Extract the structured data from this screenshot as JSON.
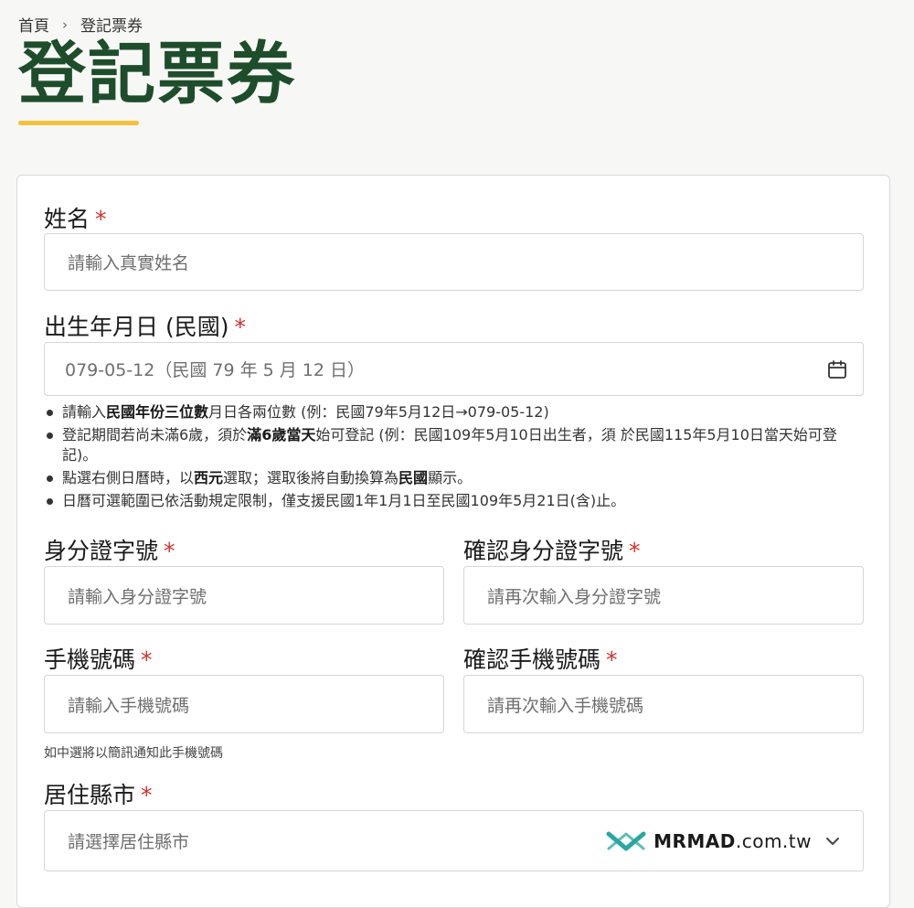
{
  "breadcrumb": {
    "home": "首頁",
    "separator": "›",
    "current": "登記票券"
  },
  "page": {
    "title": "登記票券"
  },
  "form": {
    "required_mark": "*",
    "name": {
      "label": "姓名",
      "placeholder": "請輸入真實姓名"
    },
    "birthdate": {
      "label": "出生年月日 (民國)",
      "placeholder": "079-05-12（民國 79 年 5 月 12 日）",
      "icon": "calendar-icon",
      "notes": [
        {
          "pre": "請輸入",
          "bold": "民國年份三位數",
          "post": "月日各兩位數 (例：民國79年5月12日→079-05-12)"
        },
        {
          "pre": "登記期間若尚未滿6歲，須於",
          "bold": "滿6歲當天",
          "post": "始可登記 (例：民國109年5月10日出生者，須 於民國115年5月10日當天始可登記)。"
        },
        {
          "pre": "點選右側日曆時，以",
          "bold": "西元",
          "mid": "選取；選取後將自動換算為",
          "bold2": "民國",
          "post": "顯示。"
        },
        {
          "pre": "日曆可選範圍已依活動規定限制，僅支援民國1年1月1日至民國109年5月21日(含)止。"
        }
      ]
    },
    "id_number": {
      "label": "身分證字號",
      "placeholder": "請輸入身分證字號"
    },
    "id_confirm": {
      "label": "確認身分證字號",
      "placeholder": "請再次輸入身分證字號"
    },
    "phone": {
      "label": "手機號碼",
      "placeholder": "請輸入手機號碼"
    },
    "phone_confirm": {
      "label": "確認手機號碼",
      "placeholder": "請再次輸入手機號碼"
    },
    "phone_hint": "如中選將以簡訊通知此手機號碼",
    "city": {
      "label": "居住縣市",
      "placeholder": "請選擇居住縣市",
      "icon": "chevron-down-icon"
    }
  },
  "watermark": {
    "brand": "MRMAD",
    "domain": ".com.tw",
    "logo_color": "#2aa7a0"
  },
  "colors": {
    "title": "#1e4d2b",
    "accent": "#f2c23a",
    "required": "#d0312d"
  }
}
